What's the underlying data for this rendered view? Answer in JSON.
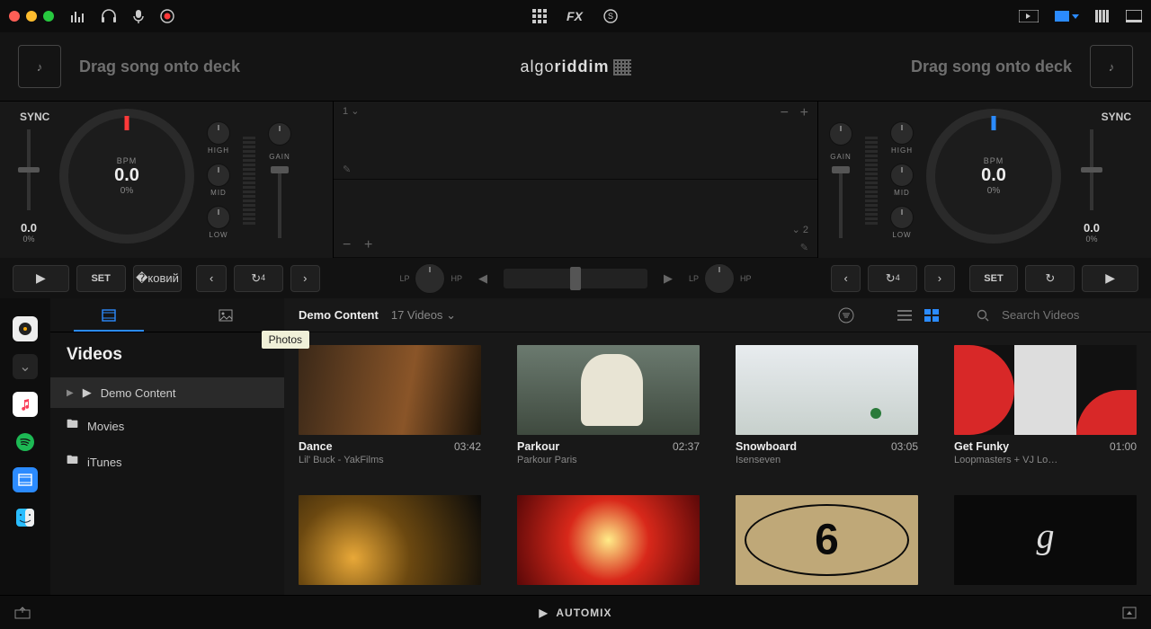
{
  "topbar": {
    "center": {
      "grid": "⊞",
      "fx": "FX",
      "circle": "◎"
    },
    "right": {
      "layout_accent": "#2b8bff"
    }
  },
  "deckheader": {
    "hint_left": "Drag song onto deck",
    "hint_right": "Drag song onto deck",
    "brand_a": "algo",
    "brand_b": "riddim"
  },
  "deck_left": {
    "sync": "SYNC",
    "bpm_label": "BPM",
    "bpm_value": "0.0",
    "bpm_pct": "0%",
    "tempo_value": "0.0",
    "tempo_pct": "0%",
    "eq": {
      "high": "HIGH",
      "mid": "MID",
      "low": "LOW",
      "gain": "GAIN"
    }
  },
  "deck_right": {
    "sync": "SYNC",
    "bpm_label": "BPM",
    "bpm_value": "0.0",
    "bpm_pct": "0%",
    "tempo_value": "0.0",
    "tempo_pct": "0%",
    "eq": {
      "high": "HIGH",
      "mid": "MID",
      "low": "LOW",
      "gain": "GAIN"
    }
  },
  "waveform": {
    "track1": "1",
    "track2": "2"
  },
  "transport": {
    "set": "SET",
    "loop": "4",
    "filter_lp": "LP",
    "filter_hp": "HP"
  },
  "browser": {
    "tooltip": "Photos",
    "sidebar_title": "Videos",
    "items": [
      {
        "label": "Demo Content",
        "icon": "▶",
        "selected": true
      },
      {
        "label": "Movies",
        "icon": "🗀",
        "selected": false
      },
      {
        "label": "iTunes",
        "icon": "▣",
        "selected": false
      }
    ],
    "header_title": "Demo Content",
    "header_count": "17 Videos",
    "search_placeholder": "Search Videos",
    "cards": [
      {
        "title": "Dance",
        "artist": "Lil' Buck - YakFilms",
        "duration": "03:42",
        "thumb": "th-dance"
      },
      {
        "title": "Parkour",
        "artist": "Parkour Paris",
        "duration": "02:37",
        "thumb": "th-parkour"
      },
      {
        "title": "Snowboard",
        "artist": "Isenseven",
        "duration": "03:05",
        "thumb": "th-snow"
      },
      {
        "title": "Get Funky",
        "artist": "Loopmasters + VJ Lo…",
        "duration": "01:00",
        "thumb": "th-funky"
      },
      {
        "title": "",
        "artist": "",
        "duration": "",
        "thumb": "th-night"
      },
      {
        "title": "",
        "artist": "",
        "duration": "",
        "thumb": "th-boombox"
      },
      {
        "title": "",
        "artist": "",
        "duration": "",
        "thumb": "th-count"
      },
      {
        "title": "",
        "artist": "",
        "duration": "",
        "thumb": "th-crazy"
      }
    ]
  },
  "footer": {
    "automix": "AUTOMIX"
  }
}
